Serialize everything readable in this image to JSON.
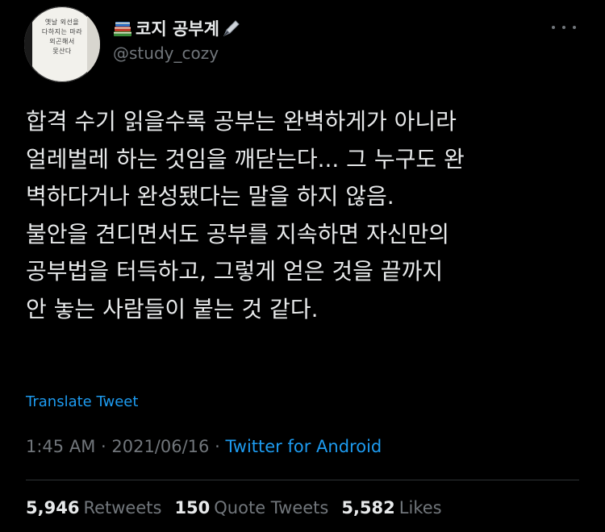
{
  "colors": {
    "background": "#000000",
    "text": "#e7e9ea",
    "secondary": "#71767b",
    "link": "#1d9bf0",
    "divider": "#2f3336"
  },
  "author": {
    "display_name": "코지 공부계",
    "name_prefix_icon": "books-icon",
    "name_suffix_icon": "pen-nib-icon",
    "handle": "@study_cozy",
    "avatar_text": [
      "옛날 외선을",
      "다하지는 마라",
      "외곤해서",
      "못산다"
    ]
  },
  "tweet": {
    "lines": [
      "합격 수기 읽을수록 공부는 완벽하게가 아니라",
      "얼레벌레 하는 것임을 깨닫는다... 그 누구도 완",
      "벽하다거나 완성됐다는 말을 하지 않음.",
      "불안을 견디면서도 공부를 지속하면 자신만의",
      "공부법을 터득하고, 그렇게 얻은 것을 끝까지",
      "안 놓는 사람들이 붙는 것 같다."
    ]
  },
  "translate_label": "Translate Tweet",
  "meta": {
    "time": "1:45 AM",
    "separator": " · ",
    "date": "2021/06/16",
    "source": "Twitter for Android"
  },
  "stats": {
    "retweets_count": "5,946",
    "retweets_label": "Retweets",
    "quotes_count": "150",
    "quotes_label": "Quote Tweets",
    "likes_count": "5,582",
    "likes_label": "Likes"
  }
}
